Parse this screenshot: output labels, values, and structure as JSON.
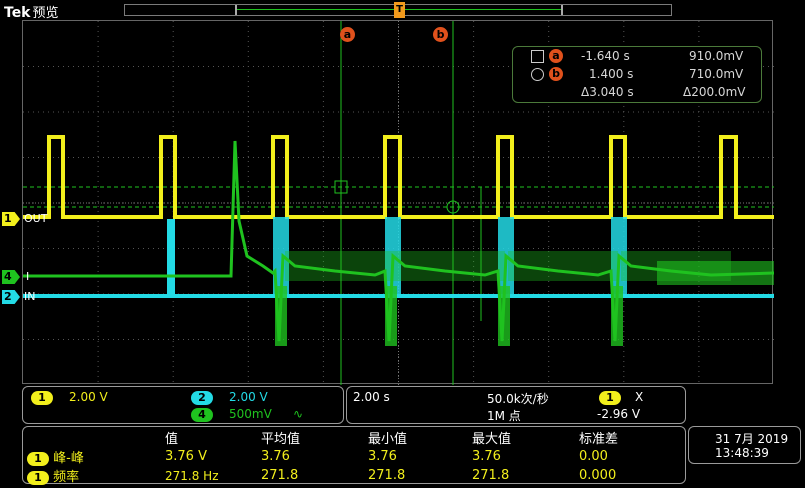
{
  "header": {
    "brand": "Tek",
    "mode": "预览"
  },
  "colors": {
    "ch1": "#f2ef1c",
    "ch2": "#23dbe6",
    "ch4": "#1fc21f",
    "cursor": "#e0511c"
  },
  "cursors": {
    "a_label": "a",
    "b_label": "b",
    "trigger_label": "T"
  },
  "channel_markers": {
    "ch1": {
      "num": "1",
      "label": "OUT"
    },
    "ch4": {
      "num": "4",
      "label": "I"
    },
    "ch2": {
      "num": "2",
      "label": "IN"
    }
  },
  "cursor_readout": {
    "a": {
      "time": "-1.640 s",
      "value": "910.0mV"
    },
    "b": {
      "time": "1.400 s",
      "value": "710.0mV"
    },
    "delta": {
      "time": "Δ3.040 s",
      "value": "Δ200.0mV"
    }
  },
  "vertical": {
    "ch1": {
      "num": "1",
      "scale": "2.00 V"
    },
    "ch2": {
      "num": "2",
      "scale": "2.00 V"
    },
    "ch4": {
      "num": "4",
      "scale": "500mV",
      "coupling": "∿"
    }
  },
  "horizontal": {
    "timebase": "2.00 s",
    "rate": "50.0k次/秒",
    "points": "1M 点"
  },
  "trigger": {
    "num": "1",
    "symbol": "X",
    "level": "-2.96 V"
  },
  "measurements": {
    "headers": [
      "值",
      "平均值",
      "最小值",
      "最大值",
      "标准差"
    ],
    "rows": [
      {
        "ch": "1",
        "name": "峰-峰",
        "value": "3.76 V",
        "mean": "3.76",
        "min": "3.76",
        "max": "3.76",
        "std": "0.00"
      },
      {
        "ch": "1",
        "name": "频率",
        "value": "271.8 Hz",
        "mean": "271.8",
        "min": "271.8",
        "max": "271.8",
        "std": "0.000"
      }
    ]
  },
  "datetime": {
    "date": "31 7月 2019",
    "time": "13:48:39"
  }
}
